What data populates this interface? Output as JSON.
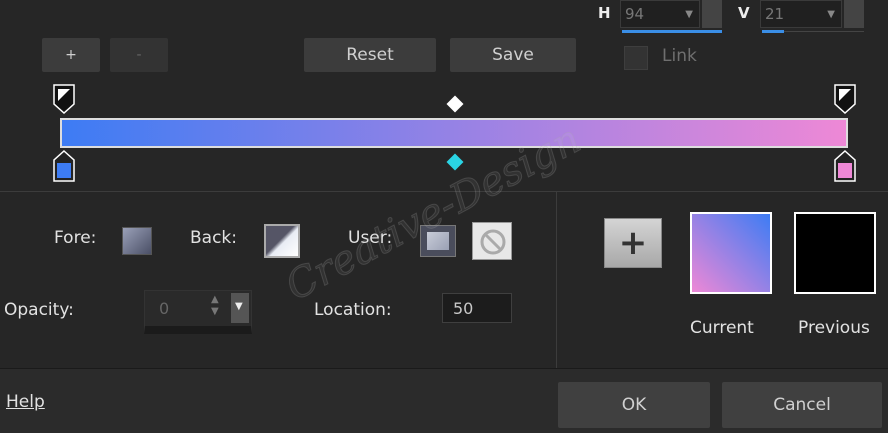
{
  "top": {
    "h_label": "H",
    "h_value": "94",
    "v_label": "V",
    "v_value": "21",
    "link_label": "Link"
  },
  "toolbar": {
    "add_label": "+",
    "remove_label": "-",
    "reset_label": "Reset",
    "save_label": "Save"
  },
  "gradient": {
    "start_color": "#3d7cf4",
    "end_color": "#ee88d6",
    "midpoint_color": "#2ad4e4"
  },
  "swatches": {
    "fore_label": "Fore:",
    "back_label": "Back:",
    "user_label": "User:"
  },
  "opacity": {
    "label": "Opacity:",
    "value": "0"
  },
  "location": {
    "label": "Location:",
    "value": "50"
  },
  "preview": {
    "add_label": "+",
    "current_label": "Current",
    "previous_label": "Previous",
    "previous_color": "#000000"
  },
  "footer": {
    "help_label": "Help",
    "ok_label": "OK",
    "cancel_label": "Cancel"
  },
  "watermark": "Creative-Design"
}
